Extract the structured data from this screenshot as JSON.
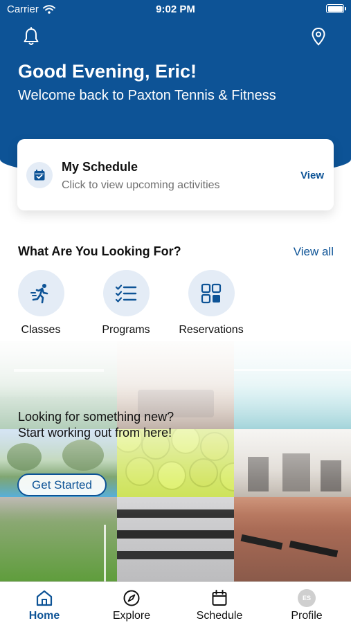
{
  "status_bar": {
    "carrier": "Carrier",
    "time": "9:02 PM"
  },
  "header": {
    "greeting": "Good Evening, Eric!",
    "welcome": "Welcome back to Paxton Tennis & Fitness",
    "left_icon": "bell-icon",
    "right_icon": "location-pin-icon"
  },
  "schedule_card": {
    "icon": "calendar-check-icon",
    "title": "My Schedule",
    "subtitle": "Click to view upcoming activities",
    "action": "View"
  },
  "section": {
    "title": "What Are You Looking For?",
    "view_all": "View all",
    "categories": [
      {
        "label": "Classes",
        "icon": "running-person-icon"
      },
      {
        "label": "Programs",
        "icon": "checklist-icon"
      },
      {
        "label": "Reservations",
        "icon": "grid-icon"
      }
    ]
  },
  "promo": {
    "line1": "Looking for something new?",
    "line2": "Start working out from here!",
    "button": "Get Started",
    "photos": [
      "tennis-court-photo",
      "lounge-photo",
      "pool-photo",
      "outdoor-pool-photo",
      "tennis-balls-photo",
      "gym-photo",
      "turf-field-photo",
      "dumbbells-photo",
      "treadmills-photo"
    ]
  },
  "tabs": [
    {
      "label": "Home",
      "icon": "home-icon",
      "active": true
    },
    {
      "label": "Explore",
      "icon": "compass-icon",
      "active": false
    },
    {
      "label": "Schedule",
      "icon": "calendar-icon",
      "active": false
    },
    {
      "label": "Profile",
      "avatar_initials": "ES",
      "active": false
    }
  ],
  "colors": {
    "brand": "#0d5396",
    "icon_bg": "#e4ecf6",
    "muted_text": "#707070"
  }
}
